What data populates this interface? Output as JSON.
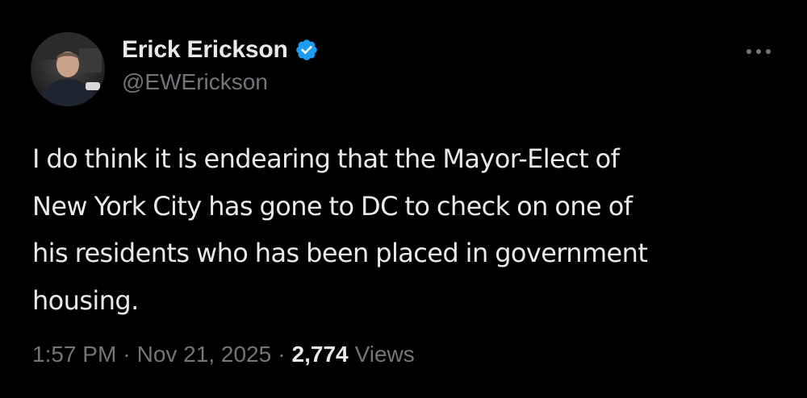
{
  "author": {
    "display_name": "Erick Erickson",
    "handle": "@EWErickson",
    "verified": true
  },
  "tweet": {
    "text_lines": [
      "I do think it is endearing that the Mayor-Elect of",
      "New York City has gone to DC to check on one of",
      "his residents who has been placed in government",
      "housing."
    ],
    "time": "1:57 PM",
    "separator": "·",
    "date": "Nov 21, 2025",
    "views_count": "2,774",
    "views_label": "Views"
  },
  "icons": {
    "verified": "verified-badge-icon",
    "more": "more-horizontal-icon"
  },
  "colors": {
    "background": "#000000",
    "primary_text": "#e7e9ea",
    "secondary_text": "#71767b",
    "verified_blue": "#1d9bf0"
  }
}
